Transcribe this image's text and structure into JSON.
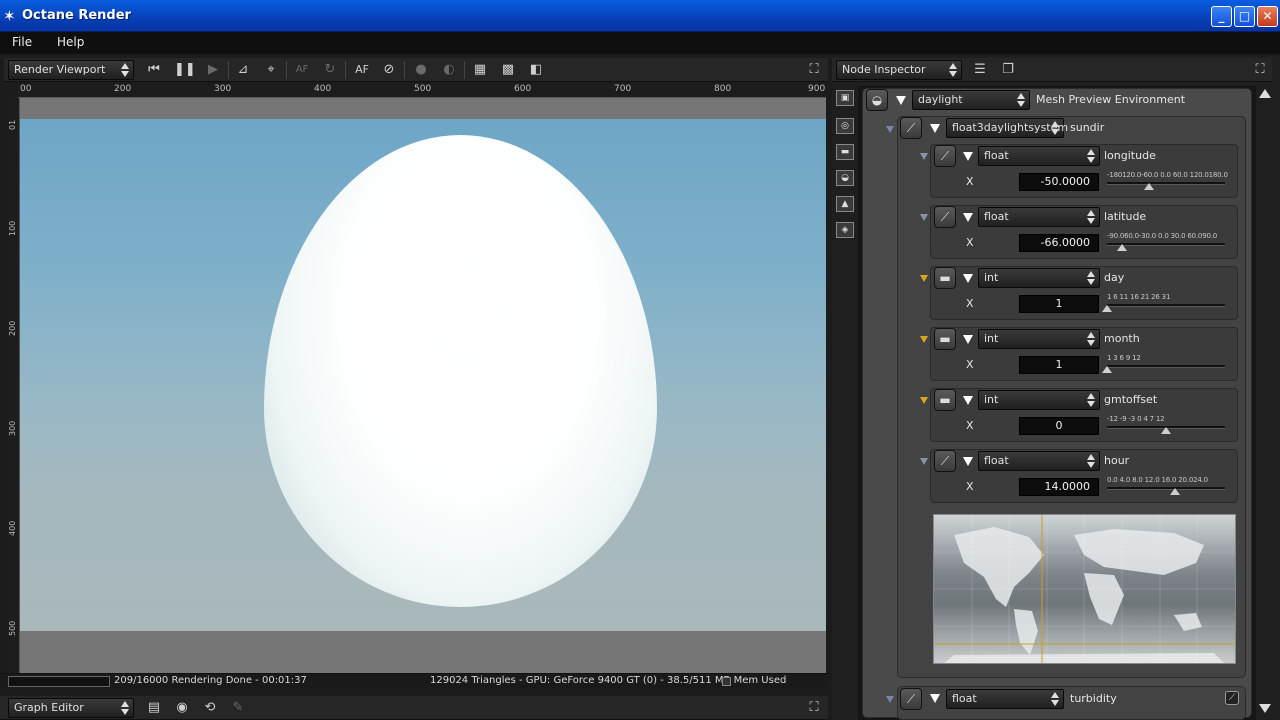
{
  "window": {
    "title": "Octane Render",
    "minimize": "_",
    "maximize": "□",
    "close": "✕"
  },
  "menu": {
    "items": [
      "File",
      "Help"
    ]
  },
  "render_toolbar": {
    "view_select": "Render Viewport",
    "icons": [
      "rewind-icon",
      "pause-icon",
      "play-icon",
      "ruler-icon",
      "focus-pick-icon",
      "af-dim-icon",
      "refresh-icon",
      "af-icon",
      "camera-off-icon",
      "sphere-icon",
      "sphere-alt-icon",
      "grid-icon",
      "checker-icon",
      "region-icon"
    ],
    "af_label": "AF",
    "af_dim_label": "AF"
  },
  "ruler": {
    "top_labels": [
      "00",
      "200",
      "300",
      "400",
      "500",
      "600",
      "700",
      "800",
      "900"
    ],
    "left_labels": [
      "01",
      "100",
      "200",
      "300",
      "400",
      "500"
    ]
  },
  "status": {
    "progress": "209/16000 Rendering Done - 00:01:37",
    "info": "129024 Triangles - GPU: GeForce 9400 GT (0) - 38.5/511 MB Mem Used"
  },
  "graph_editor": {
    "select": "Graph Editor"
  },
  "node_inspector": {
    "select": "Node Inspector",
    "root": {
      "type": "daylight",
      "label": "Mesh Preview Environment"
    },
    "sundir": {
      "type": "float3daylightsystem",
      "label": "sundir"
    },
    "params": [
      {
        "type": "float",
        "name": "longitude",
        "axis": "X",
        "value": "-50.0000",
        "ticks": "-180120.0-60.0  0.0  60.0 120.0180.0",
        "level": 0.36
      },
      {
        "type": "float",
        "name": "latitude",
        "axis": "X",
        "value": "-66.0000",
        "ticks": "-90.060.0-30.0  0.0  30.0  60.090.0",
        "level": 0.13
      },
      {
        "type": "int",
        "name": "day",
        "axis": "X",
        "value": "1",
        "ticks": "1    6    11    16    21    26   31",
        "level": 0.0
      },
      {
        "type": "int",
        "name": "month",
        "axis": "X",
        "value": "1",
        "ticks": "1      3       6       9     12",
        "level": 0.0
      },
      {
        "type": "int",
        "name": "gmtoffset",
        "axis": "X",
        "value": "0",
        "ticks": "-12 -9   -3   0    4    7   12",
        "level": 0.5
      },
      {
        "type": "float",
        "name": "hour",
        "axis": "X",
        "value": "14.0000",
        "ticks": "0.0 4.0  8.0 12.0 16.0 20.024.0",
        "level": 0.58
      }
    ],
    "turbidity": {
      "type": "float",
      "label": "turbidity"
    }
  }
}
